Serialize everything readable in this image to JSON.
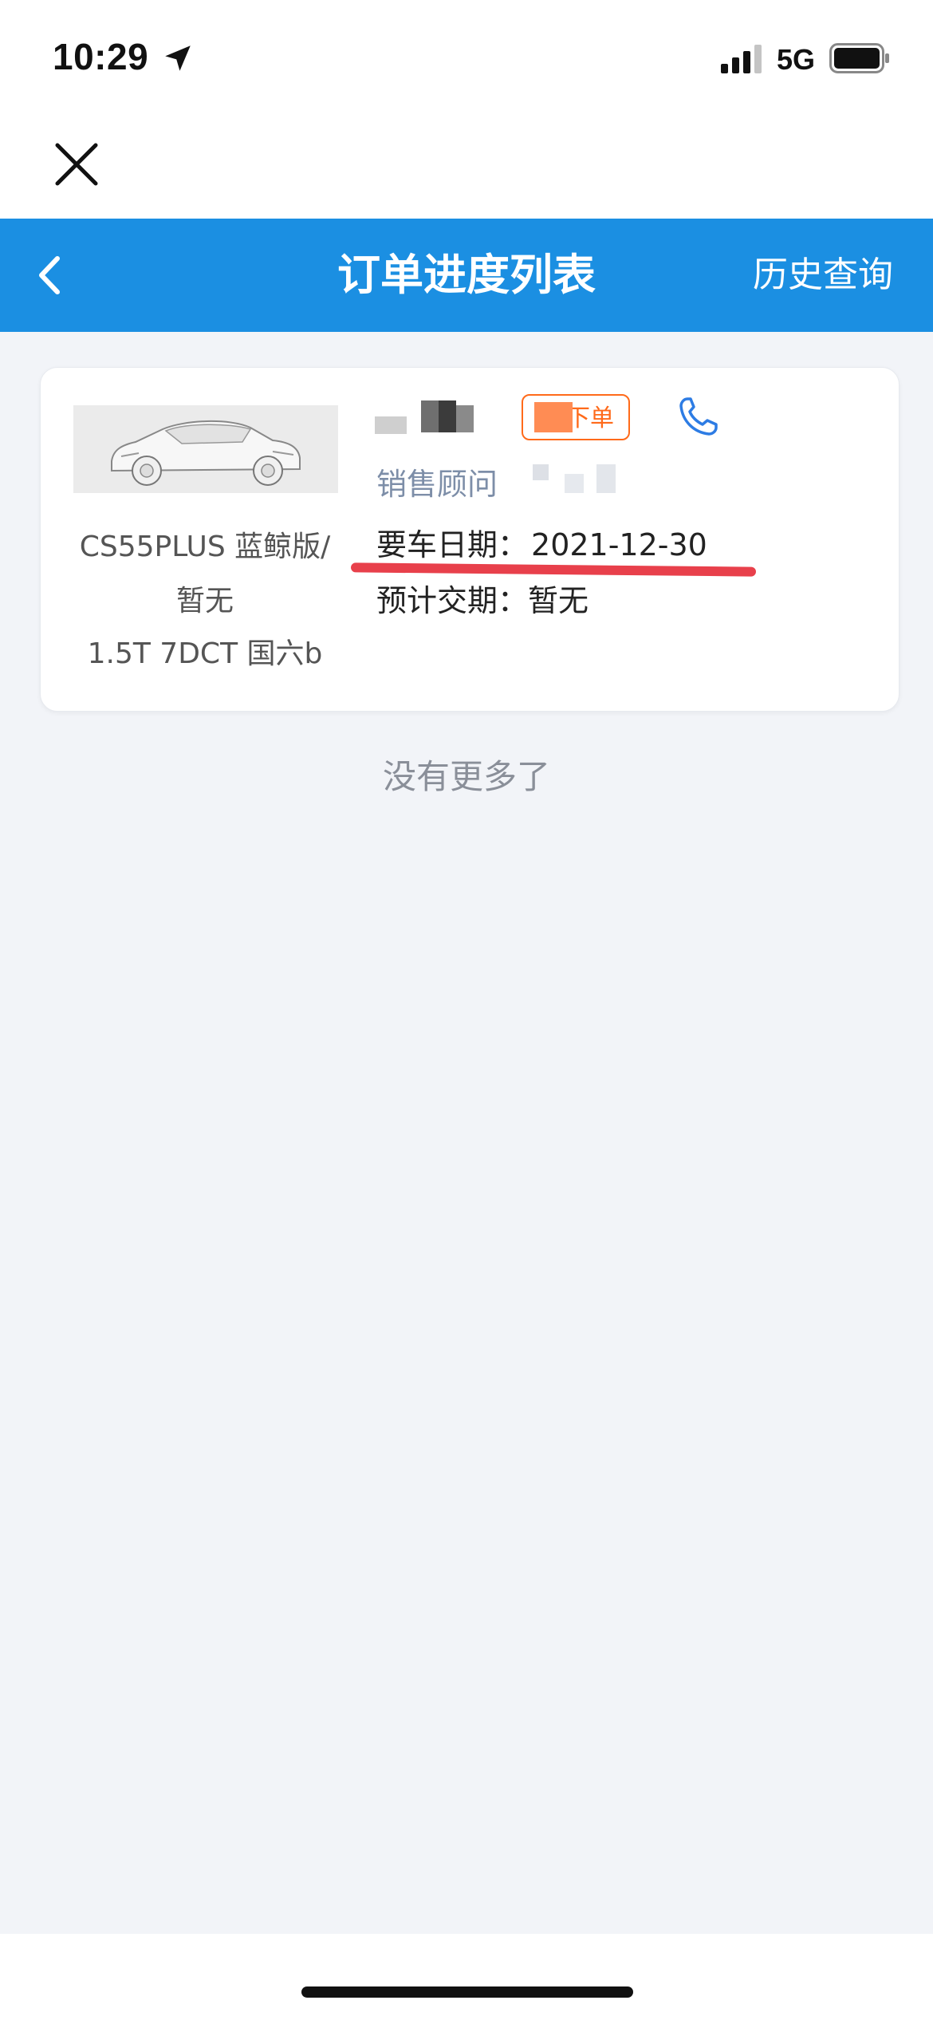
{
  "status_bar": {
    "time": "10:29",
    "network": "5G",
    "icons": [
      "location-arrow-icon",
      "signal-bars-icon",
      "battery-icon"
    ]
  },
  "header": {
    "title": "订单进度列表",
    "history_link": "历史查询",
    "icons": [
      "close-icon",
      "back-chevron-icon"
    ],
    "nav_color": "#1b8fe2"
  },
  "order": {
    "car_name_line1": "CS55PLUS 蓝鲸版/",
    "car_name_line2": "暂无",
    "car_spec": "1.5T 7DCT 国六b",
    "status_text": "下单",
    "advisor_label": "销售顾问",
    "pickup_label": "要车日期：",
    "pickup_date": "2021-12-30",
    "delivery_label": "预计交期：",
    "delivery_value": "暂无",
    "status_color": "#ff6a1a",
    "highlight_color": "#e8404b"
  },
  "footer": {
    "no_more_text": "没有更多了"
  }
}
